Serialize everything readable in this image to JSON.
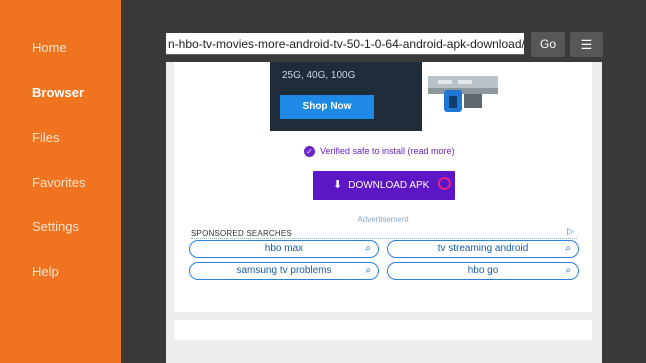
{
  "sidebar": {
    "items": [
      {
        "label": "Home",
        "active": false
      },
      {
        "label": "Browser",
        "active": true
      },
      {
        "label": "Files",
        "active": false
      },
      {
        "label": "Favorites",
        "active": false
      },
      {
        "label": "Settings",
        "active": false
      },
      {
        "label": "Help",
        "active": false
      }
    ]
  },
  "toolbar": {
    "url": "n-hbo-tv-movies-more-android-tv-50-1-0-64-android-apk-download/",
    "go_label": "Go",
    "menu_icon": "☰"
  },
  "page": {
    "ad": {
      "text": "25G, 40G, 100G",
      "shop_label": "Shop Now"
    },
    "verified_text": "Verified safe to install (read more)",
    "verified_icon": "✓",
    "download_icon": "⬇",
    "download_label": "DOWNLOAD APK",
    "advertisement_label": "Advertisement",
    "sponsored_label": "SPONSORED SEARCHES",
    "adchoices_icon": "▷",
    "search_icon": "⌕",
    "sponsored_searches": [
      "hbo max",
      "tv streaming android",
      "samsung tv problems",
      "hbo go"
    ]
  },
  "colors": {
    "sidebar": "#f0731f",
    "download_button": "#5c16c5",
    "verified": "#6b24c7",
    "accent_blue": "#1f8ae6"
  }
}
